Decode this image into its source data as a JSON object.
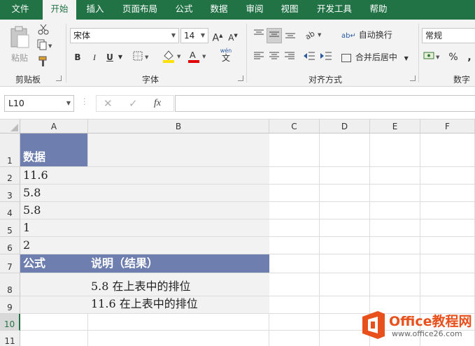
{
  "tabs": [
    "文件",
    "开始",
    "插入",
    "页面布局",
    "公式",
    "数据",
    "审阅",
    "视图",
    "开发工具",
    "帮助"
  ],
  "ribbon": {
    "clipboard": {
      "paste_label": "粘贴",
      "group_label": "剪贴板"
    },
    "font": {
      "font_name": "宋体",
      "font_size": "14",
      "bold": "B",
      "italic": "I",
      "underline": "U",
      "wen": "wén",
      "wen2": "文",
      "grow": "A",
      "shrink": "A",
      "group_label": "字体"
    },
    "alignment": {
      "wrap_label": "自动换行",
      "merge_label": "合并后居中",
      "group_label": "对齐方式"
    },
    "number": {
      "format": "常规",
      "percent": "%",
      "comma": ",",
      "group_label": "数字"
    }
  },
  "formula_bar": {
    "name_box": "L10",
    "fx": "fx",
    "formula": ""
  },
  "columns": [
    "A",
    "B",
    "C",
    "D",
    "E",
    "F"
  ],
  "rows": [
    "1",
    "2",
    "3",
    "4",
    "5",
    "6",
    "7",
    "8",
    "9",
    "10",
    "11"
  ],
  "cells": {
    "A1": "数据",
    "A2": "11.6",
    "A3": "5.8",
    "A4": "5.8",
    "A5": "1",
    "A6": "2",
    "A7": "公式",
    "B7": "说明（结果）",
    "B8": "5.8 在上表中的排位",
    "B9": "11.6 在上表中的排位"
  },
  "colors": {
    "accent": "#217346",
    "header_fill": "#6e7faf",
    "data_fill": "#f2f2f2",
    "logo_orange": "#e8501c"
  },
  "watermark": {
    "brand": "Office教程网",
    "url": "www.office26.com"
  }
}
